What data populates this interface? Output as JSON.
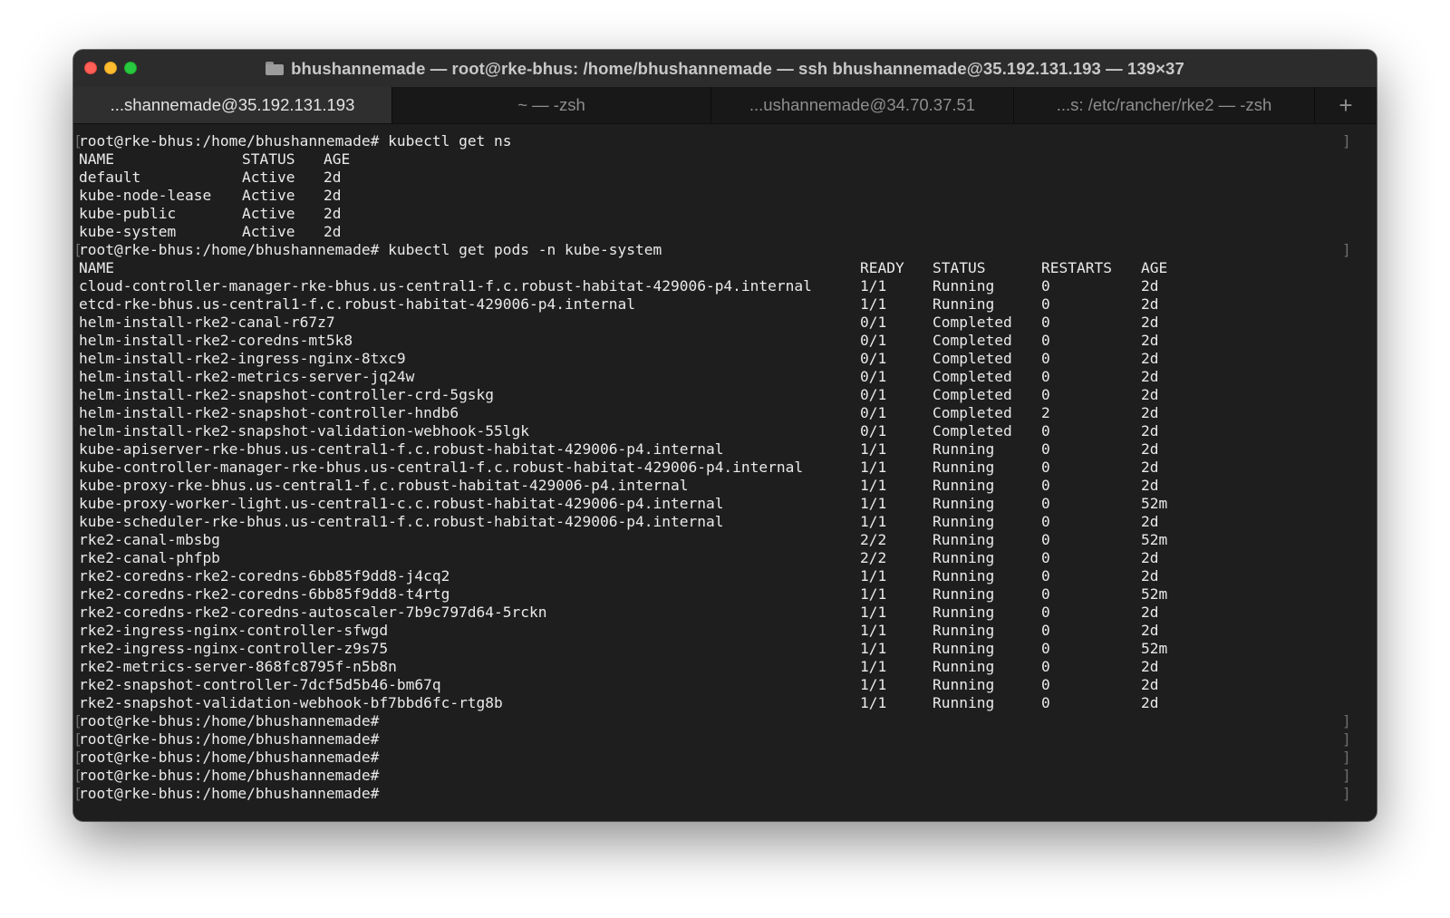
{
  "window": {
    "title": "bhushannemade — root@rke-bhus: /home/bhushannemade — ssh bhushannemade@35.192.131.193 — 139×37",
    "tabs": [
      {
        "label": "...shannemade@35.192.131.193",
        "active": true
      },
      {
        "label": "~ — -zsh",
        "active": false
      },
      {
        "label": "...ushannemade@34.70.37.51",
        "active": false
      },
      {
        "label": "...s: /etc/rancher/rke2 — -zsh",
        "active": false
      }
    ],
    "new_tab_label": "+"
  },
  "terminal": {
    "prompt": "root@rke-bhus:/home/bhushannemade#",
    "cmd1": " kubectl get ns",
    "ns_headers": [
      "NAME",
      "STATUS",
      "AGE"
    ],
    "namespaces": [
      [
        "default",
        "Active",
        "2d"
      ],
      [
        "kube-node-lease",
        "Active",
        "2d"
      ],
      [
        "kube-public",
        "Active",
        "2d"
      ],
      [
        "kube-system",
        "Active",
        "2d"
      ]
    ],
    "cmd2": " kubectl get pods -n kube-system",
    "pod_headers": [
      "NAME",
      "READY",
      "STATUS",
      "RESTARTS",
      "AGE"
    ],
    "pods": [
      [
        "cloud-controller-manager-rke-bhus.us-central1-f.c.robust-habitat-429006-p4.internal",
        "1/1",
        "Running",
        "0",
        "2d"
      ],
      [
        "etcd-rke-bhus.us-central1-f.c.robust-habitat-429006-p4.internal",
        "1/1",
        "Running",
        "0",
        "2d"
      ],
      [
        "helm-install-rke2-canal-r67z7",
        "0/1",
        "Completed",
        "0",
        "2d"
      ],
      [
        "helm-install-rke2-coredns-mt5k8",
        "0/1",
        "Completed",
        "0",
        "2d"
      ],
      [
        "helm-install-rke2-ingress-nginx-8txc9",
        "0/1",
        "Completed",
        "0",
        "2d"
      ],
      [
        "helm-install-rke2-metrics-server-jq24w",
        "0/1",
        "Completed",
        "0",
        "2d"
      ],
      [
        "helm-install-rke2-snapshot-controller-crd-5gskg",
        "0/1",
        "Completed",
        "0",
        "2d"
      ],
      [
        "helm-install-rke2-snapshot-controller-hndb6",
        "0/1",
        "Completed",
        "2",
        "2d"
      ],
      [
        "helm-install-rke2-snapshot-validation-webhook-55lgk",
        "0/1",
        "Completed",
        "0",
        "2d"
      ],
      [
        "kube-apiserver-rke-bhus.us-central1-f.c.robust-habitat-429006-p4.internal",
        "1/1",
        "Running",
        "0",
        "2d"
      ],
      [
        "kube-controller-manager-rke-bhus.us-central1-f.c.robust-habitat-429006-p4.internal",
        "1/1",
        "Running",
        "0",
        "2d"
      ],
      [
        "kube-proxy-rke-bhus.us-central1-f.c.robust-habitat-429006-p4.internal",
        "1/1",
        "Running",
        "0",
        "2d"
      ],
      [
        "kube-proxy-worker-light.us-central1-c.c.robust-habitat-429006-p4.internal",
        "1/1",
        "Running",
        "0",
        "52m"
      ],
      [
        "kube-scheduler-rke-bhus.us-central1-f.c.robust-habitat-429006-p4.internal",
        "1/1",
        "Running",
        "0",
        "2d"
      ],
      [
        "rke2-canal-mbsbg",
        "2/2",
        "Running",
        "0",
        "52m"
      ],
      [
        "rke2-canal-phfpb",
        "2/2",
        "Running",
        "0",
        "2d"
      ],
      [
        "rke2-coredns-rke2-coredns-6bb85f9dd8-j4cq2",
        "1/1",
        "Running",
        "0",
        "2d"
      ],
      [
        "rke2-coredns-rke2-coredns-6bb85f9dd8-t4rtg",
        "1/1",
        "Running",
        "0",
        "52m"
      ],
      [
        "rke2-coredns-rke2-coredns-autoscaler-7b9c797d64-5rckn",
        "1/1",
        "Running",
        "0",
        "2d"
      ],
      [
        "rke2-ingress-nginx-controller-sfwgd",
        "1/1",
        "Running",
        "0",
        "2d"
      ],
      [
        "rke2-ingress-nginx-controller-z9s75",
        "1/1",
        "Running",
        "0",
        "52m"
      ],
      [
        "rke2-metrics-server-868fc8795f-n5b8n",
        "1/1",
        "Running",
        "0",
        "2d"
      ],
      [
        "rke2-snapshot-controller-7dcf5d5b46-bm67q",
        "1/1",
        "Running",
        "0",
        "2d"
      ],
      [
        "rke2-snapshot-validation-webhook-bf7bbd6fc-rtg8b",
        "1/1",
        "Running",
        "0",
        "2d"
      ]
    ],
    "trailing_prompts": 5
  },
  "colors": {
    "terminal_bg": "#1e1e1e",
    "text": "#eaeaea",
    "titlebar_bg": "#2d2c2d",
    "tab_active_bg": "#2f2f2f",
    "tabbar_bg": "#181818"
  },
  "icons": [
    "folder-icon",
    "close-button",
    "minimize-button",
    "zoom-button"
  ]
}
